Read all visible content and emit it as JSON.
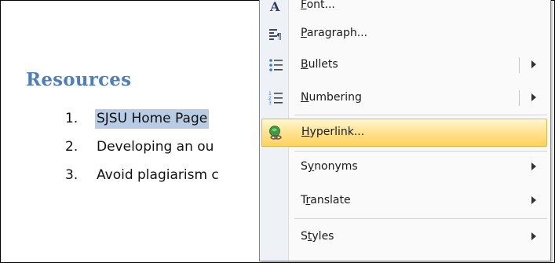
{
  "document": {
    "heading": "Resources",
    "list": [
      {
        "num": "1.",
        "text": "SJSU Home Page",
        "selected": true
      },
      {
        "num": "2.",
        "text": "Developing an ou"
      },
      {
        "num": "3.",
        "text": "Avoid plagiarism c"
      }
    ]
  },
  "context_menu": {
    "items": [
      {
        "label_pre": "",
        "label_u": "F",
        "label_post": "ont...",
        "icon": "font-icon"
      },
      {
        "label_pre": "",
        "label_u": "P",
        "label_post": "aragraph...",
        "icon": "paragraph-icon"
      },
      {
        "label_pre": "",
        "label_u": "B",
        "label_post": "ullets",
        "icon": "bullets-icon",
        "submenu": true
      },
      {
        "label_pre": "",
        "label_u": "N",
        "label_post": "umbering",
        "icon": "numbering-icon",
        "submenu": true
      },
      {
        "label_pre": "",
        "label_u": "H",
        "label_post": "yperlink...",
        "icon": "hyperlink-icon",
        "highlighted": true
      },
      {
        "label_pre": "S",
        "label_u": "y",
        "label_post": "nonyms",
        "submenu": true
      },
      {
        "label_pre": "T",
        "label_u": "r",
        "label_post": "anslate",
        "submenu": true
      },
      {
        "label_pre": "S",
        "label_u": "t",
        "label_post": "yles",
        "submenu": true
      }
    ],
    "colors": {
      "highlight": "#ffe08a",
      "heading": "#4f7fba",
      "selection": "#b8cce4"
    }
  }
}
